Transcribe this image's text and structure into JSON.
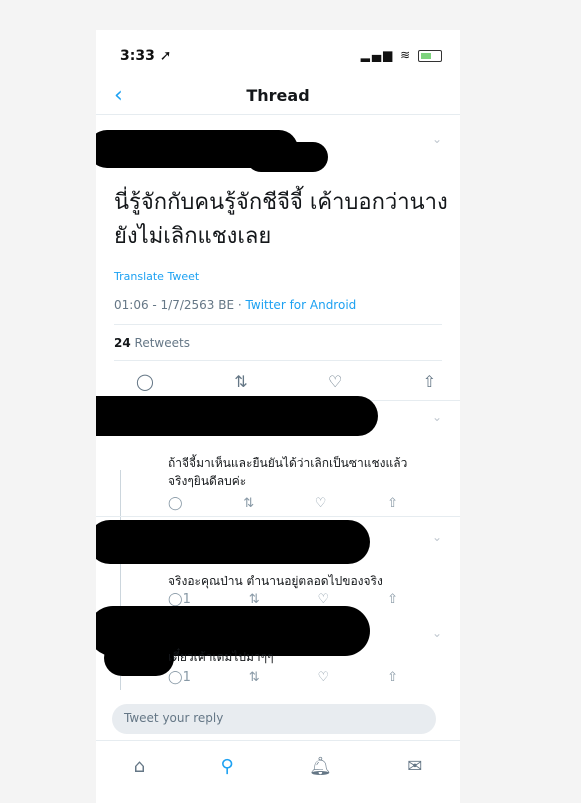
{
  "status_bar": {
    "time": "3:33 ➚"
  },
  "nav": {
    "title": "Thread",
    "back": "‹"
  },
  "tweet": {
    "text": "นี่รู้จักกับคนรู้จักชีจีจี้ เค้าบอกว่านางยังไม่เลิกแชงเลย",
    "translate": "Translate Tweet",
    "timestamp": "01:06 - 1/7/2563 BE",
    "separator": " · ",
    "client": "Twitter for Android",
    "retweet_count": "24",
    "retweet_label": "Retweets"
  },
  "replies": [
    {
      "text": "ถ้าจีจี้มาเห็นและยืนยันได้ว่าเลิกเป็นซาแชงแล้วจริงๆยินดีลบค่ะ",
      "reply_count": ""
    },
    {
      "text": "จริงอะคุณป่าน ตำนานอยู่ตลอดไปของจริง",
      "reply_count": "1"
    },
    {
      "text": "เดี๋ยวเค้าเดมไปมาๆๆ",
      "reply_count": "1"
    }
  ],
  "composer": {
    "placeholder": "Tweet your reply"
  },
  "tabbar": {
    "active": "search"
  },
  "colors": {
    "accent": "#1da1f2",
    "text": "#14171a",
    "muted": "#657786"
  }
}
